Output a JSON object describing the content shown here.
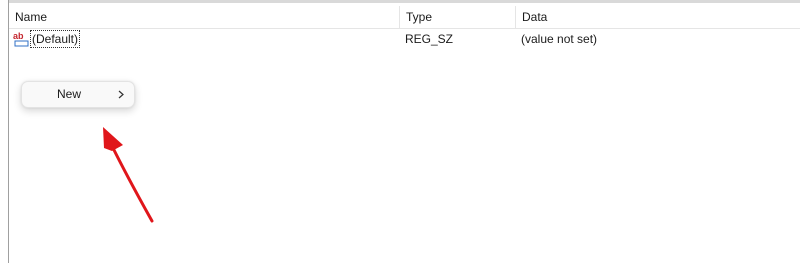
{
  "list": {
    "columns": {
      "name": "Name",
      "type": "Type",
      "data": "Data"
    },
    "rows": [
      {
        "name": "(Default)",
        "type": "REG_SZ",
        "data": "(value not set)",
        "icon": "reg-string-ab-icon"
      }
    ]
  },
  "context_menu": {
    "items": [
      {
        "label": "New",
        "icon": "chevron-right-icon"
      }
    ]
  },
  "annotation": {
    "arrow_color": "#e0161b"
  },
  "colors": {
    "icon_red": "#c4262e",
    "icon_blue": "#2f6fc6"
  }
}
